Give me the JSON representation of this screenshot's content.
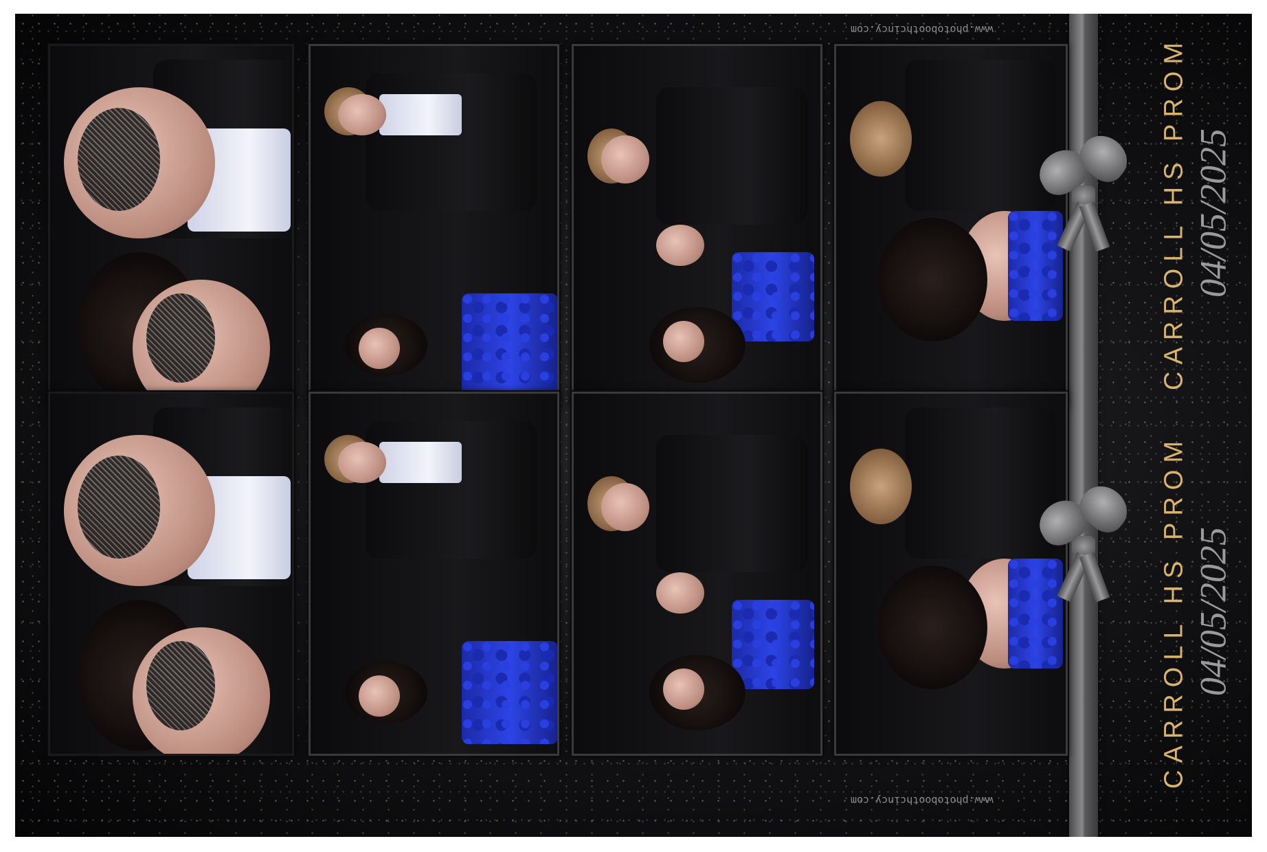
{
  "print": {
    "strips": [
      {
        "title": "CARROLL HS PROM",
        "date": "04/05/2025",
        "website": "www.photoboothcincy.com"
      },
      {
        "title": "CARROLL HS PROM",
        "date": "04/05/2025",
        "website": "www.photoboothcincy.com"
      }
    ],
    "colors": {
      "title": "#d9b46a",
      "date": "#9a9a9c",
      "background": "#121214",
      "ribbon": "#8a8a8c"
    }
  }
}
